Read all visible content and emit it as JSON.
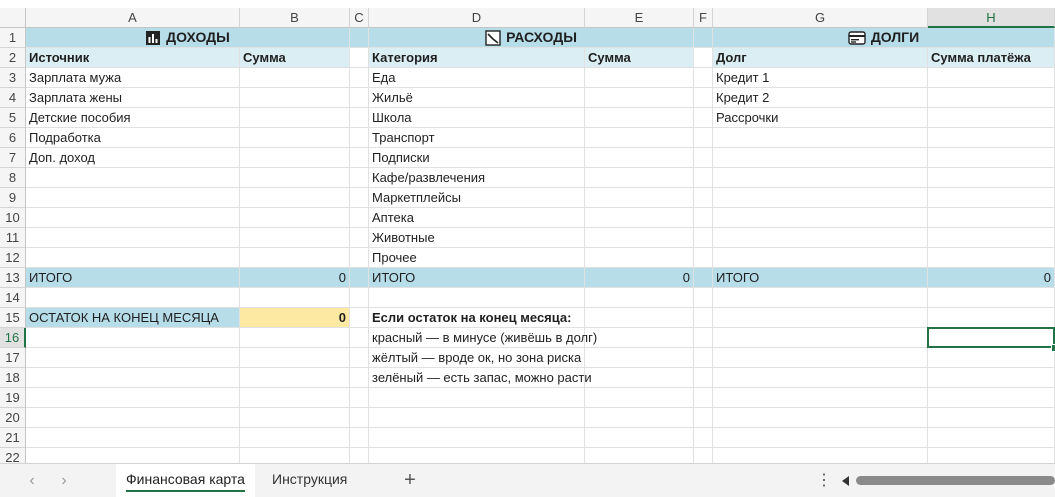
{
  "columns": [
    "A",
    "B",
    "C",
    "D",
    "E",
    "F",
    "G",
    "H"
  ],
  "rows": [
    "1",
    "2",
    "3",
    "4",
    "5",
    "6",
    "7",
    "8",
    "9",
    "10",
    "11",
    "12",
    "13",
    "14",
    "15",
    "16",
    "17",
    "18",
    "19",
    "20",
    "21",
    "22"
  ],
  "income": {
    "title": "ДОХОДЫ",
    "icon": "bar-chart-icon",
    "header_source": "Источник",
    "header_amount": "Сумма",
    "items": [
      "Зарплата мужа",
      "Зарплата жены",
      "Детские пособия",
      "Подработка",
      "Доп. доход"
    ],
    "total_label": "ИТОГО",
    "total_value": "0"
  },
  "expenses": {
    "title": "РАСХОДЫ",
    "icon": "line-chart-icon",
    "header_category": "Категория",
    "header_amount": "Сумма",
    "items": [
      "Еда",
      "Жильё",
      "Школа",
      "Транспорт",
      "Подписки",
      "Кафе/развлечения",
      "Маркетплейсы",
      "Аптека",
      "Животные",
      "Прочее"
    ],
    "total_label": "ИТОГО",
    "total_value": "0"
  },
  "debts": {
    "title": "ДОЛГИ",
    "icon": "credit-card-icon",
    "header_debt": "Долг",
    "header_payment": "Сумма платёжа",
    "items": [
      "Кредит 1",
      "Кредит 2",
      "Рассрочки"
    ],
    "total_label": "ИТОГО",
    "total_value": "0"
  },
  "balance": {
    "label": "ОСТАТОК НА КОНЕЦ МЕСЯЦА",
    "value": "0"
  },
  "legend": {
    "title": "Если остаток на конец месяца:",
    "lines": [
      "красный — в минусе (живёшь в долг)",
      "жёлтый — вроде ок, но зона риска",
      "зелёный — есть запас, можно расти"
    ]
  },
  "selection": {
    "cell": "H16"
  },
  "tabs": [
    {
      "label": "Финансовая карта",
      "active": true
    },
    {
      "label": "Инструкция",
      "active": false
    }
  ],
  "colors": {
    "section_header": "#b7dde8",
    "column_header": "#daeef3",
    "balance_value": "#fde9a2",
    "accent": "#217346"
  }
}
